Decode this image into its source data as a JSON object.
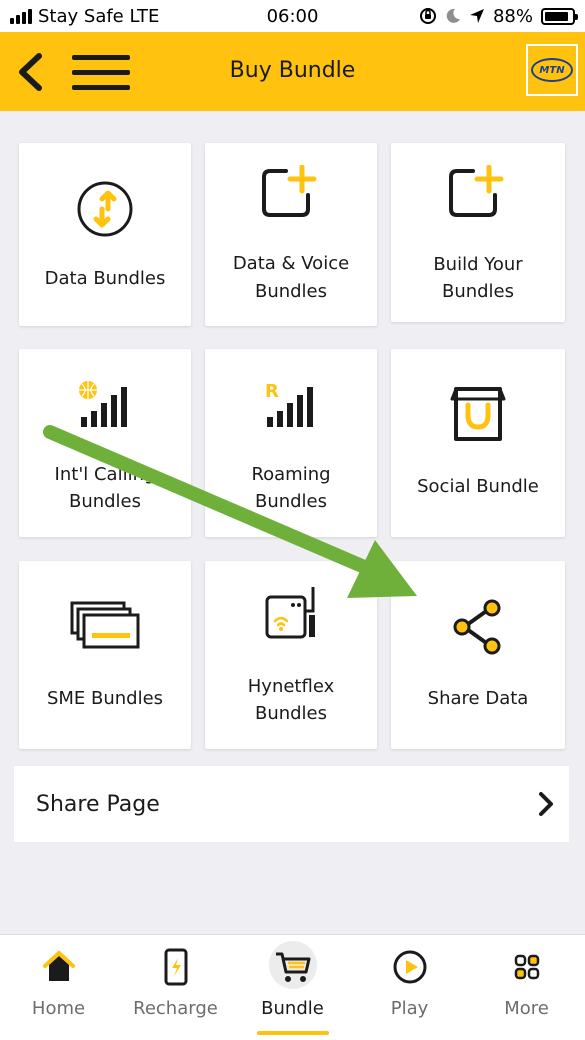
{
  "status_bar": {
    "carrier": "Stay Safe LTE",
    "time": "06:00",
    "battery": "88%",
    "battery_level": 0.88
  },
  "header": {
    "title": "Buy Bundle",
    "logo_text": "MTN"
  },
  "tiles": [
    {
      "label_line1": "Data Bundles",
      "label_line2": "",
      "icon": "data-transfer-icon"
    },
    {
      "label_line1": "Data & Voice",
      "label_line2": "Bundles",
      "icon": "add-square-icon"
    },
    {
      "label_line1": "Build Your",
      "label_line2": "Bundles",
      "icon": "add-square-icon"
    },
    {
      "label_line1": "Int'l Calling",
      "label_line2": "Bundles",
      "icon": "globe-signal-icon"
    },
    {
      "label_line1": "Roaming",
      "label_line2": "Bundles",
      "icon": "roaming-signal-icon"
    },
    {
      "label_line1": "Social Bundle",
      "label_line2": "",
      "icon": "shopping-bag-icon"
    },
    {
      "label_line1": "SME Bundles",
      "label_line2": "",
      "icon": "stacked-cards-icon"
    },
    {
      "label_line1": "Hynetflex",
      "label_line2": "Bundles",
      "icon": "router-icon"
    },
    {
      "label_line1": "Share Data",
      "label_line2": "",
      "icon": "share-icon"
    }
  ],
  "share_page": {
    "label": "Share Page"
  },
  "bottom_nav": [
    {
      "label": "Home",
      "icon": "home-icon"
    },
    {
      "label": "Recharge",
      "icon": "phone-recharge-icon"
    },
    {
      "label": "Bundle",
      "icon": "cart-icon",
      "active": true
    },
    {
      "label": "Play",
      "icon": "play-icon"
    },
    {
      "label": "More",
      "icon": "grid-icon"
    }
  ],
  "colors": {
    "brand_yellow": "#ffc20e",
    "annotation_green": "#6fb03b",
    "background": "#efeff3"
  }
}
